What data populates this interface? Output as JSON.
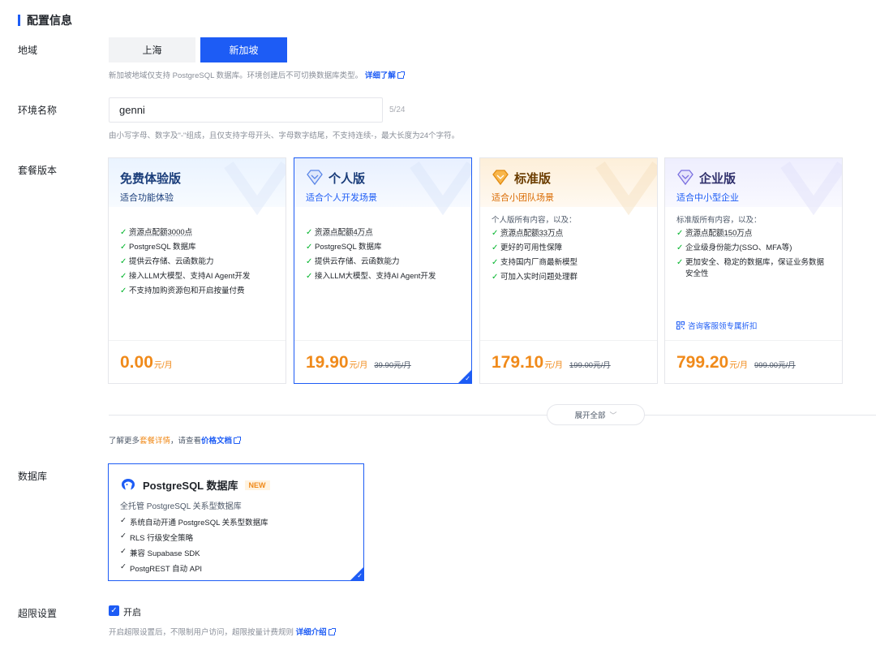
{
  "header": {
    "title": "配置信息"
  },
  "region": {
    "label": "地域",
    "options": [
      "上海",
      "新加坡"
    ],
    "selected": "新加坡",
    "hint": "新加坡地域仅支持 PostgreSQL 数据库。环境创建后不可切换数据库类型。",
    "hint_link": "详细了解"
  },
  "env_name": {
    "label": "环境名称",
    "value": "genni",
    "count": "5/24",
    "hint": "由小写字母、数字及\"-\"组成，且仅支持字母开头、字母数字结尾，不支持连续-，最大长度为24个字符。"
  },
  "plans": {
    "label": "套餐版本",
    "items": [
      {
        "name": "免费体验版",
        "subtitle": "适合功能体验",
        "prefix": "",
        "features": [
          "资源点配额3000点",
          "PostgreSQL 数据库",
          "提供云存储、云函数能力",
          "接入LLM大模型、支持AI Agent开发",
          "不支持加购资源包和开启按量付费"
        ],
        "price": "0.00",
        "unit": "元/月",
        "original": ""
      },
      {
        "name": "个人版",
        "subtitle": "适合个人开发场景",
        "prefix": "",
        "features": [
          "资源点配额4万点",
          "PostgreSQL 数据库",
          "提供云存储、云函数能力",
          "接入LLM大模型、支持AI Agent开发"
        ],
        "price": "19.90",
        "unit": "元/月",
        "original": "39.90元/月",
        "selected": true
      },
      {
        "name": "标准版",
        "subtitle": "适合小团队场景",
        "prefix": "个人版所有内容，以及：",
        "features": [
          "资源点配额33万点",
          "更好的可用性保障",
          "支持国内厂商最新模型",
          "可加入实时问题处理群"
        ],
        "price": "179.10",
        "unit": "元/月",
        "original": "199.00元/月"
      },
      {
        "name": "企业版",
        "subtitle": "适合中小型企业",
        "prefix": "标准版所有内容，以及：",
        "features": [
          "资源点配额150万点",
          "企业级身份能力(SSO、MFA等)",
          "更加安全、稳定的数据库，保证业务数据安全性"
        ],
        "consult": "咨询客服领专属折扣",
        "price": "799.20",
        "unit": "元/月",
        "original": "999.00元/月"
      }
    ],
    "expand_label": "展开全部",
    "more_prefix": "了解更多",
    "more_link1": "套餐详情",
    "more_mid": "，请查看",
    "more_link2": "价格文档"
  },
  "database": {
    "label": "数据库",
    "title": "PostgreSQL 数据库",
    "badge": "NEW",
    "desc": "全托管 PostgreSQL 关系型数据库",
    "features": [
      "系统自动开通 PostgreSQL 关系型数据库",
      "RLS 行级安全策略",
      "兼容 Supabase SDK",
      "PostgREST 自动 API"
    ]
  },
  "overlimit": {
    "label": "超限设置",
    "checkbox_label": "开启",
    "checked": true,
    "hint": "开启超限设置后，不限制用户访问，超限按量计费规则",
    "hint_link": "详细介绍"
  },
  "colors": {
    "primary": "#1d5cf5",
    "price": "#f08a1a",
    "check": "#00b42a"
  }
}
